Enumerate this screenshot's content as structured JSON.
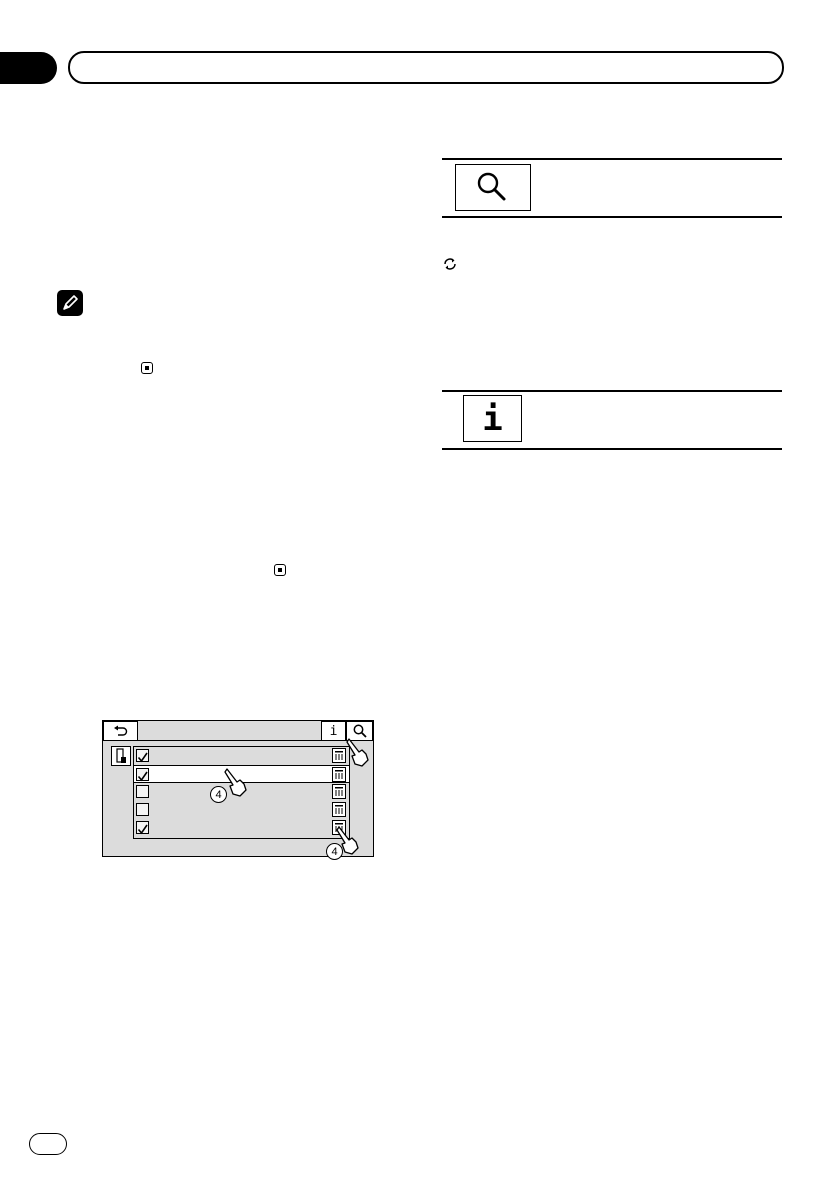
{
  "header": {
    "tab": "",
    "title": ""
  },
  "icons": {
    "note": "pencil-icon",
    "end_mark": "stop-square-icon",
    "search": "magnifier-icon",
    "info": "info-icon",
    "loop": "repeat-icon"
  },
  "info_button": {
    "glyph": "i"
  },
  "screen": {
    "back_icon": "back-arrow-icon",
    "info_label": "i",
    "search_icon": "magnifier-icon",
    "rows": [
      {
        "checked": true
      },
      {
        "checked": true
      },
      {
        "checked": false
      },
      {
        "checked": false
      },
      {
        "checked": true
      }
    ],
    "step_badges": [
      "4",
      "4"
    ]
  },
  "footer": {
    "page_number": ""
  }
}
